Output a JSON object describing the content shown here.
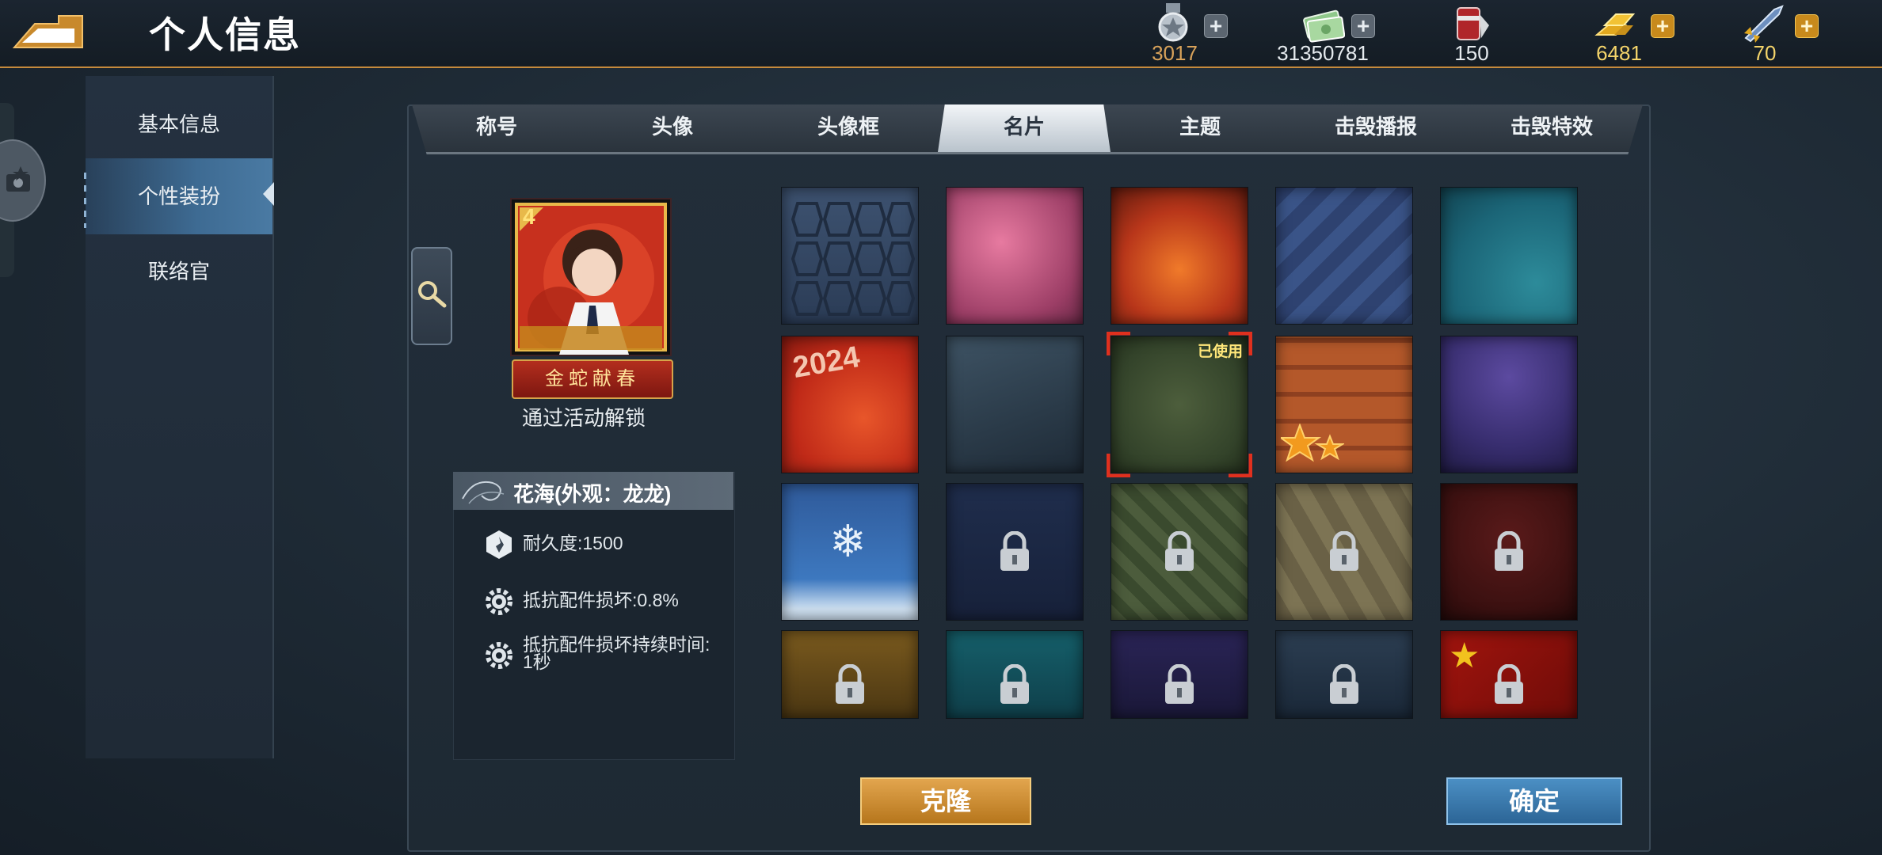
{
  "header": {
    "title": "个人信息",
    "back_icon": "back-arrow-icon"
  },
  "resources": [
    {
      "icon": "medal-icon",
      "value": "3017",
      "plus": "grey",
      "color": "#d8a25a"
    },
    {
      "icon": "cash-icon",
      "value": "31350781",
      "plus": "grey",
      "color": "#e6ebef"
    },
    {
      "icon": "paint-bucket-icon",
      "value": "150",
      "plus": "none",
      "color": "#e6ebef"
    },
    {
      "icon": "gold-bars-icon",
      "value": "6481",
      "plus": "gold",
      "color": "#f4d46a"
    },
    {
      "icon": "rocket-icon",
      "value": "70",
      "plus": "gold",
      "color": "#f4d46a"
    }
  ],
  "sidebar": {
    "items": [
      {
        "label": "基本信息",
        "active": false
      },
      {
        "label": "个性装扮",
        "active": true
      },
      {
        "label": "联络官",
        "active": false
      }
    ]
  },
  "tabs": [
    {
      "label": "称号",
      "active": false
    },
    {
      "label": "头像",
      "active": false
    },
    {
      "label": "头像框",
      "active": false
    },
    {
      "label": "名片",
      "active": true
    },
    {
      "label": "主题",
      "active": false
    },
    {
      "label": "击毁播报",
      "active": false
    },
    {
      "label": "击毁特效",
      "active": false
    }
  ],
  "preview": {
    "card_number": "4",
    "ribbon_text": "金蛇献春",
    "unlock_text": "通过活动解锁"
  },
  "info": {
    "title": "花海(外观：龙龙)",
    "rows": [
      {
        "icon": "durability-icon",
        "text": "耐久度:1500"
      },
      {
        "icon": "gear-icon",
        "text": "抵抗配件损坏:0.8%"
      },
      {
        "icon": "gear-icon",
        "text": "抵抗配件损坏持续时间:",
        "text2": "1秒"
      }
    ]
  },
  "skins": {
    "used_label": "已使用",
    "year_text": "2024",
    "items": [
      {
        "style": "hex-blue",
        "locked": false
      },
      {
        "style": "pink-hearts",
        "locked": false
      },
      {
        "style": "fire",
        "locked": false
      },
      {
        "style": "blue-stripes",
        "locked": false
      },
      {
        "style": "teal-swirl",
        "locked": false
      },
      {
        "style": "red-2024",
        "locked": false
      },
      {
        "style": "book-pages",
        "locked": false
      },
      {
        "style": "green-camo",
        "locked": false,
        "used": true
      },
      {
        "style": "orange-tiles",
        "locked": false
      },
      {
        "style": "purple-night",
        "locked": false
      },
      {
        "style": "snow",
        "locked": false
      },
      {
        "style": "navy-star",
        "locked": true
      },
      {
        "style": "digital-camo",
        "locked": true
      },
      {
        "style": "tan-diamond",
        "locked": true
      },
      {
        "style": "dark-red",
        "locked": true
      },
      {
        "style": "amber",
        "locked": true
      },
      {
        "style": "teal-sea",
        "locked": true
      },
      {
        "style": "purple-bird",
        "locked": true
      },
      {
        "style": "heli-night",
        "locked": true
      },
      {
        "style": "red-flag",
        "locked": true
      }
    ]
  },
  "buttons": {
    "clone": "克隆",
    "confirm": "确定"
  },
  "colors": {
    "accent_gold": "#c58a3c",
    "selection_red": "#e0301e",
    "used_yellow": "#ffe77a"
  }
}
